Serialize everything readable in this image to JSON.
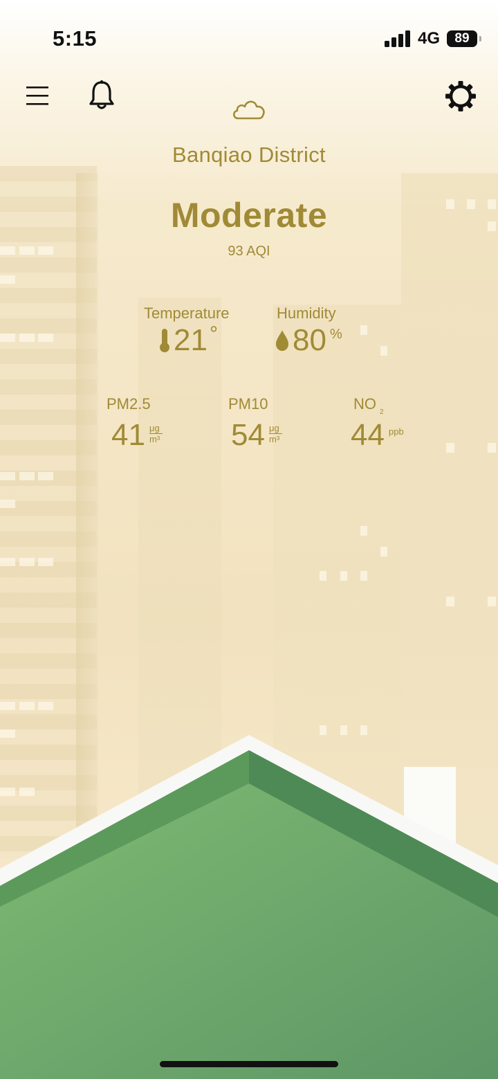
{
  "status_bar": {
    "time": "5:15",
    "network": "4G",
    "battery": "89"
  },
  "header": {
    "weather_icon": "cloud-icon"
  },
  "location": {
    "district": "Banqiao District"
  },
  "air_quality": {
    "level": "Moderate",
    "aqi_text": "93 AQI"
  },
  "climate": {
    "temperature": {
      "label": "Temperature",
      "value": "21",
      "unit": "°"
    },
    "humidity": {
      "label": "Humidity",
      "value": "80",
      "unit": "%"
    }
  },
  "pollutants": {
    "pm25": {
      "label": "PM2.5",
      "value": "41",
      "unit_top": "μg",
      "unit_bottom": "m³"
    },
    "pm10": {
      "label": "PM10",
      "value": "54",
      "unit_top": "μg",
      "unit_bottom": "m³"
    },
    "no2": {
      "label": "NO",
      "sub": "2",
      "value": "44",
      "unit": "ppb"
    }
  },
  "colors": {
    "accent": "#a08a36",
    "roof": "#7bb56f",
    "background": "#f6eacd"
  }
}
